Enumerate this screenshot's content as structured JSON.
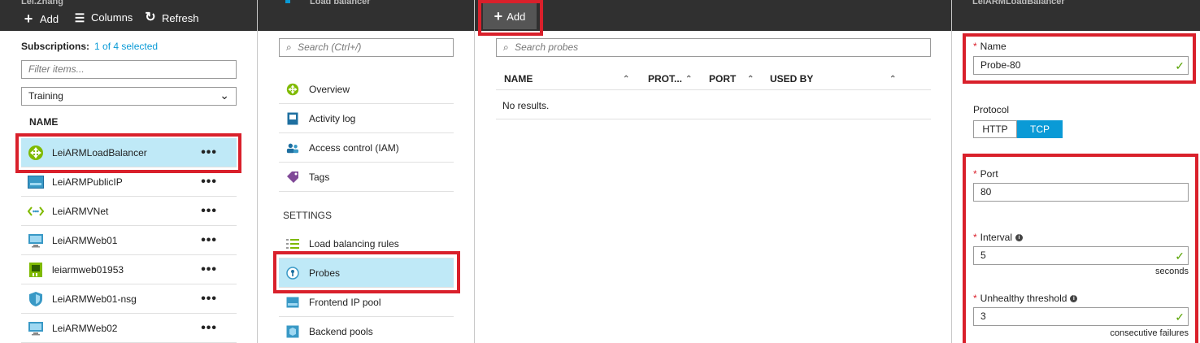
{
  "blade1": {
    "title": "Lei.Zhang",
    "toolbar": {
      "add": "Add",
      "columns": "Columns",
      "refresh": "Refresh"
    },
    "subscriptions_label": "Subscriptions:",
    "subscriptions_value": "1 of 4 selected",
    "filter_placeholder": "Filter items...",
    "dropdown_value": "Training",
    "name_header": "NAME",
    "items": [
      {
        "label": "LeiARMLoadBalancer",
        "icon": "load-balancer-icon"
      },
      {
        "label": "LeiARMPublicIP",
        "icon": "public-ip-icon"
      },
      {
        "label": "LeiARMVNet",
        "icon": "vnet-icon"
      },
      {
        "label": "LeiARMWeb01",
        "icon": "vm-icon"
      },
      {
        "label": "leiarmweb01953",
        "icon": "nic-icon"
      },
      {
        "label": "LeiARMWeb01-nsg",
        "icon": "nsg-icon"
      },
      {
        "label": "LeiARMWeb02",
        "icon": "vm-icon"
      }
    ],
    "more": "•••"
  },
  "blade2": {
    "title": "Load balancer",
    "search_placeholder": "Search (Ctrl+/)",
    "menu": [
      {
        "label": "Overview",
        "icon": "overview-icon"
      },
      {
        "label": "Activity log",
        "icon": "activity-log-icon"
      },
      {
        "label": "Access control (IAM)",
        "icon": "iam-icon"
      },
      {
        "label": "Tags",
        "icon": "tag-icon"
      }
    ],
    "settings_header": "SETTINGS",
    "settings": [
      {
        "label": "Load balancing rules",
        "icon": "rules-icon"
      },
      {
        "label": "Probes",
        "icon": "probe-icon"
      },
      {
        "label": "Frontend IP pool",
        "icon": "frontend-icon"
      },
      {
        "label": "Backend pools",
        "icon": "backend-icon"
      }
    ]
  },
  "blade3": {
    "add": "Add",
    "search_placeholder": "Search probes",
    "columns": [
      "NAME",
      "PROT...",
      "PORT",
      "USED BY"
    ],
    "empty": "No results."
  },
  "blade4": {
    "title": "LeiARMLoadBalancer",
    "name_label": "Name",
    "name_value": "Probe-80",
    "protocol_label": "Protocol",
    "protocol_options": [
      "HTTP",
      "TCP"
    ],
    "port_label": "Port",
    "port_value": "80",
    "interval_label": "Interval",
    "interval_value": "5",
    "interval_unit": "seconds",
    "threshold_label": "Unhealthy threshold",
    "threshold_value": "3",
    "threshold_unit": "consecutive failures"
  },
  "colors": {
    "accent": "#0a9ad6",
    "selected_bg": "#bfe9f7",
    "highlight": "#d9202b",
    "toolbar": "#303030",
    "valid": "#57a300"
  }
}
